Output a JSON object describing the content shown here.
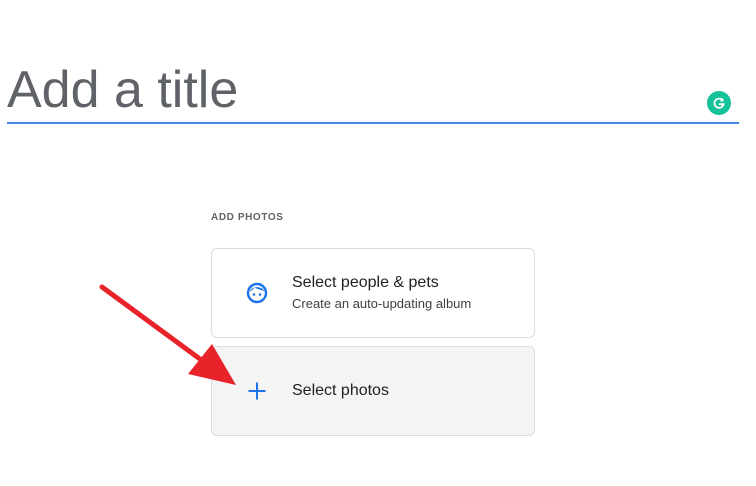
{
  "title": {
    "placeholder": "Add a title"
  },
  "add_photos": {
    "section_label": "ADD PHOTOS",
    "people_card": {
      "title": "Select people & pets",
      "subtitle": "Create an auto-updating album",
      "icon": "face-icon"
    },
    "photos_card": {
      "title": "Select photos",
      "icon": "plus-icon"
    }
  },
  "colors": {
    "accent_blue": "#1a73e8",
    "underline": "#4a86e8",
    "grammarly": "#15c39a",
    "annotation_arrow": "#e8232a"
  }
}
